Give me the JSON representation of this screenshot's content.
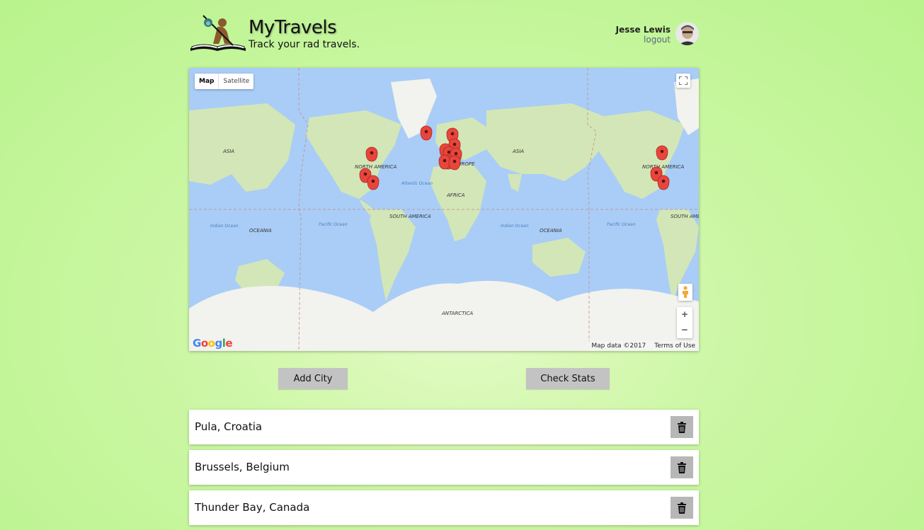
{
  "header": {
    "title": "MyTravels",
    "tagline": "Track your rad travels.",
    "user_name": "Jesse Lewis",
    "logout_label": "logout"
  },
  "map": {
    "type_controls": [
      "Map",
      "Satellite"
    ],
    "active_type": "Map",
    "attribution": "Map data ©2017",
    "terms": "Terms of Use",
    "google_logo": "Google",
    "zoom_in": "+",
    "zoom_out": "−",
    "labels": {
      "asia_left": "ASIA",
      "asia_right": "ASIA",
      "north_america_left": "NORTH AMERICA",
      "north_america_right": "NORTH AMERICA",
      "south_america_left": "SOUTH AMERICA",
      "south_america_right": "SOUTH AMERICA",
      "africa": "AFRICA",
      "europe": "EUROPE",
      "oceania_left": "OCEANIA",
      "oceania_right": "OCEANIA",
      "antarctica": "ANTARCTICA",
      "atlantic": "Atlantic Ocean",
      "pacific_left": "Pacific Ocean",
      "pacific_right": "Pacific Ocean",
      "indian_left": "Indian Ocean",
      "indian_right": "Indian Ocean"
    },
    "icons": [
      "fullscreen-icon",
      "pegman-icon",
      "map-marker-icon"
    ]
  },
  "actions": {
    "add_city": "Add City",
    "check_stats": "Check Stats"
  },
  "cities": [
    "Pula, Croatia",
    "Brussels, Belgium",
    "Thunder Bay, Canada"
  ],
  "colors": {
    "background": "#c4f59a",
    "ocean": "#a9cdf6",
    "land": "#cfe4b2",
    "marker": "#e8453c",
    "button": "#c3c3c3"
  }
}
